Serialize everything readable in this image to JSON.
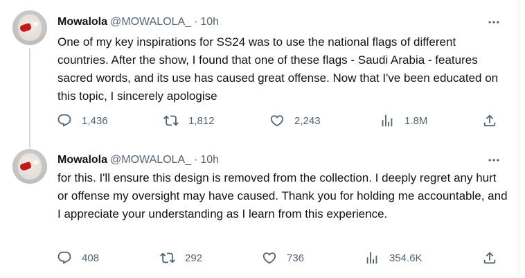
{
  "tweets": [
    {
      "name": "Mowalola",
      "handle": "@MOWALOLA_",
      "separator": "·",
      "time": "10h",
      "more_icon": "more-horizontal-icon",
      "text": "One of my key inspirations for SS24 was to use the national flags of different countries. After the show, I found that one of these flags - Saudi Arabia - features sacred words, and its use has caused great offense. Now that I've been educated on this topic, I sincerely apologise",
      "replies": "1,436",
      "reposts": "1,812",
      "likes": "2,243",
      "views": "1.8M"
    },
    {
      "name": "Mowalola",
      "handle": "@MOWALOLA_",
      "separator": "·",
      "time": "10h",
      "more_icon": "more-horizontal-icon",
      "text": "for this. I'll ensure this design is removed from the collection. I deeply regret any hurt or offense my oversight may have caused. Thank you for holding me accountable, and I appreciate your understanding as I learn from this experience.",
      "replies": "408",
      "reposts": "292",
      "likes": "736",
      "views": "354.6K"
    }
  ],
  "icons": {
    "reply": "reply-icon",
    "repost": "repost-icon",
    "like": "heart-icon",
    "views": "views-chart-icon",
    "share": "share-icon"
  },
  "colors": {
    "text_primary": "#0f1419",
    "text_secondary": "#536471",
    "thread_line": "#cfd9de",
    "background": "#ffffff"
  }
}
